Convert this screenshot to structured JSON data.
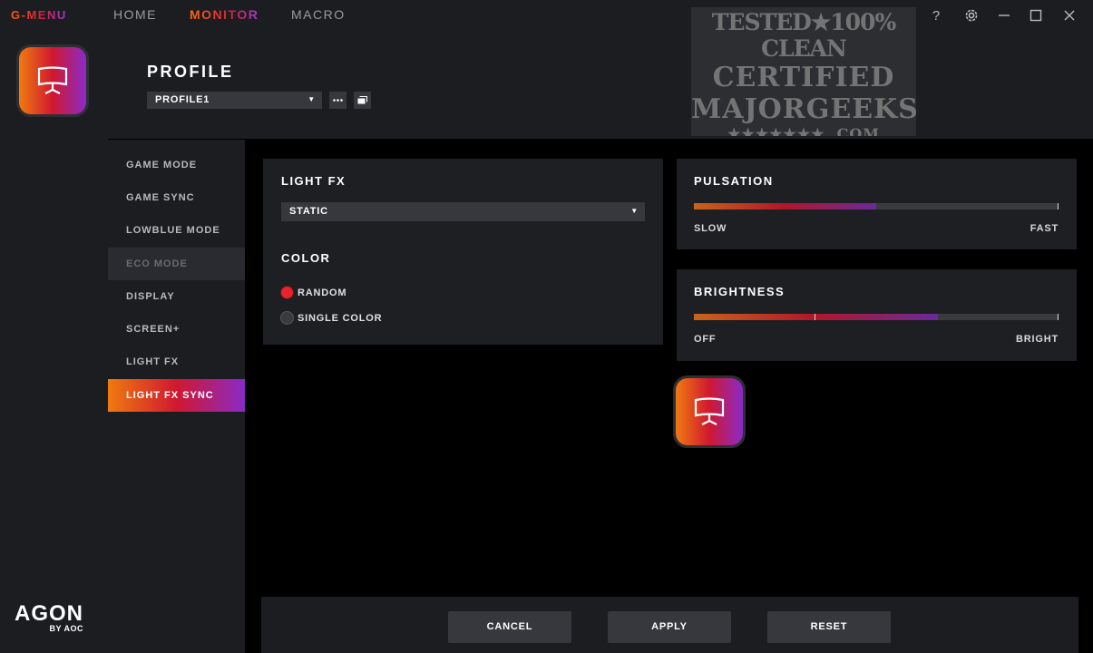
{
  "topbar": {
    "brand": "G-MENU",
    "nav": [
      {
        "label": "HOME",
        "active": false
      },
      {
        "label": "MONITOR",
        "active": true
      },
      {
        "label": "MACRO",
        "active": false
      }
    ]
  },
  "header": {
    "title": "PROFILE",
    "profile_selected": "PROFILE1"
  },
  "watermark": {
    "line1": "TESTED★100% CLEAN",
    "line2": "CERTIFIED",
    "line3": "MAJORGEEKS",
    "line4": "★★★★★★★ .COM"
  },
  "sidemenu": {
    "items": [
      {
        "label": "GAME MODE"
      },
      {
        "label": "GAME SYNC"
      },
      {
        "label": "LOWBLUE MODE"
      },
      {
        "label": "ECO MODE"
      },
      {
        "label": "DISPLAY"
      },
      {
        "label": "SCREEN+"
      },
      {
        "label": "LIGHT FX"
      },
      {
        "label": "LIGHT FX SYNC"
      }
    ]
  },
  "lightfx": {
    "title": "LIGHT FX",
    "effect_selected": "STATIC",
    "color_title": "COLOR",
    "options": [
      {
        "label": "RANDOM",
        "selected": true
      },
      {
        "label": "SINGLE COLOR",
        "selected": false
      }
    ]
  },
  "pulsation": {
    "title": "PULSATION",
    "value_fraction": 0.5,
    "min_label": "SLOW",
    "max_label": "FAST"
  },
  "brightness": {
    "title": "BRIGHTNESS",
    "value_fraction": 0.67,
    "marker_fraction": 0.33,
    "min_label": "OFF",
    "max_label": "BRIGHT"
  },
  "footer": {
    "cancel": "CANCEL",
    "apply": "APPLY",
    "reset": "RESET"
  },
  "logo": {
    "word": "AGON",
    "sub": "BY AOC"
  },
  "colors": {
    "accent_orange": "#f07a10",
    "accent_red": "#d01830",
    "accent_purple": "#8a2ac8",
    "radio_on": "#e8232c"
  }
}
